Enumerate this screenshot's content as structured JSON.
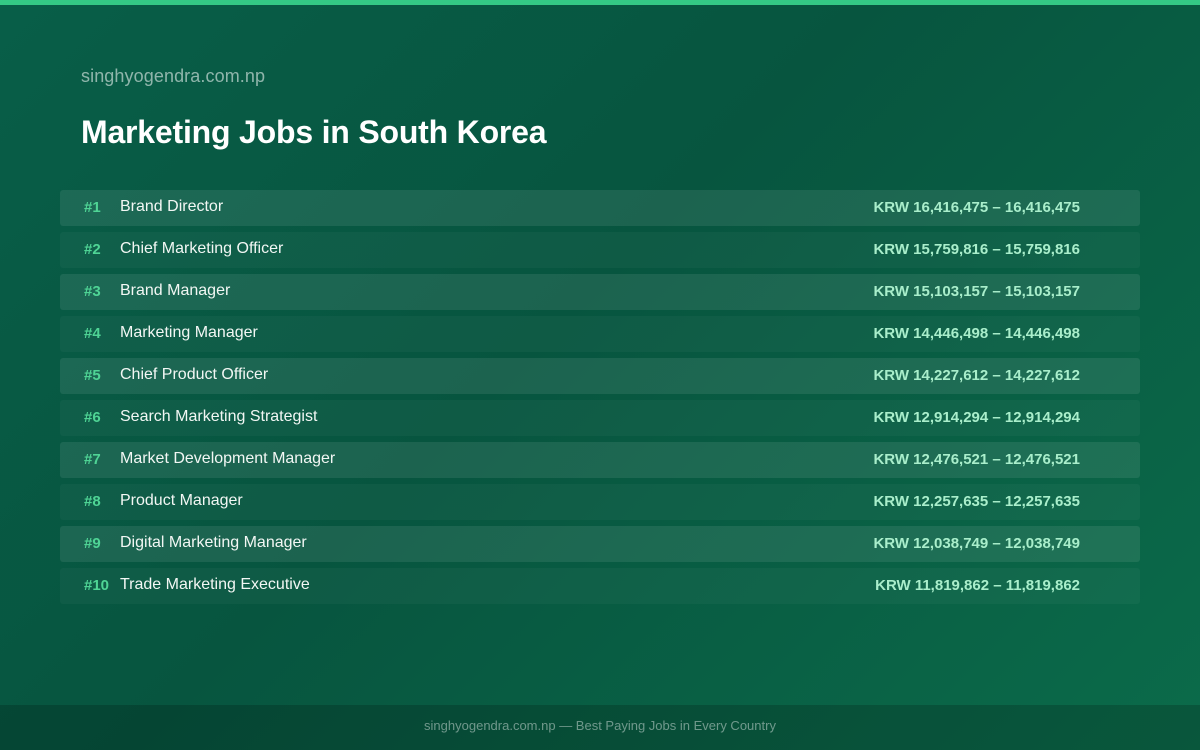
{
  "header": {
    "site_name": "singhyogendra.com.np",
    "title": "Marketing Jobs in South Korea"
  },
  "colors": {
    "background": "#085e48",
    "accent_bar": "#34c985",
    "rank": "#4fd495",
    "salary": "#a9eecb"
  },
  "jobs": [
    {
      "rank": "#1",
      "title": "Brand Director",
      "salary": "KRW 16,416,475 – 16,416,475"
    },
    {
      "rank": "#2",
      "title": "Chief Marketing Officer",
      "salary": "KRW 15,759,816 – 15,759,816"
    },
    {
      "rank": "#3",
      "title": "Brand Manager",
      "salary": "KRW 15,103,157 – 15,103,157"
    },
    {
      "rank": "#4",
      "title": "Marketing Manager",
      "salary": "KRW 14,446,498 – 14,446,498"
    },
    {
      "rank": "#5",
      "title": "Chief Product Officer",
      "salary": "KRW 14,227,612 – 14,227,612"
    },
    {
      "rank": "#6",
      "title": "Search Marketing Strategist",
      "salary": "KRW 12,914,294 – 12,914,294"
    },
    {
      "rank": "#7",
      "title": "Market Development Manager",
      "salary": "KRW 12,476,521 – 12,476,521"
    },
    {
      "rank": "#8",
      "title": "Product Manager",
      "salary": "KRW 12,257,635 – 12,257,635"
    },
    {
      "rank": "#9",
      "title": "Digital Marketing Manager",
      "salary": "KRW 12,038,749 – 12,038,749"
    },
    {
      "rank": "#10",
      "title": "Trade Marketing Executive",
      "salary": "KRW 11,819,862 – 11,819,862"
    }
  ],
  "footer": {
    "text": "singhyogendra.com.np — Best Paying Jobs in Every Country"
  }
}
